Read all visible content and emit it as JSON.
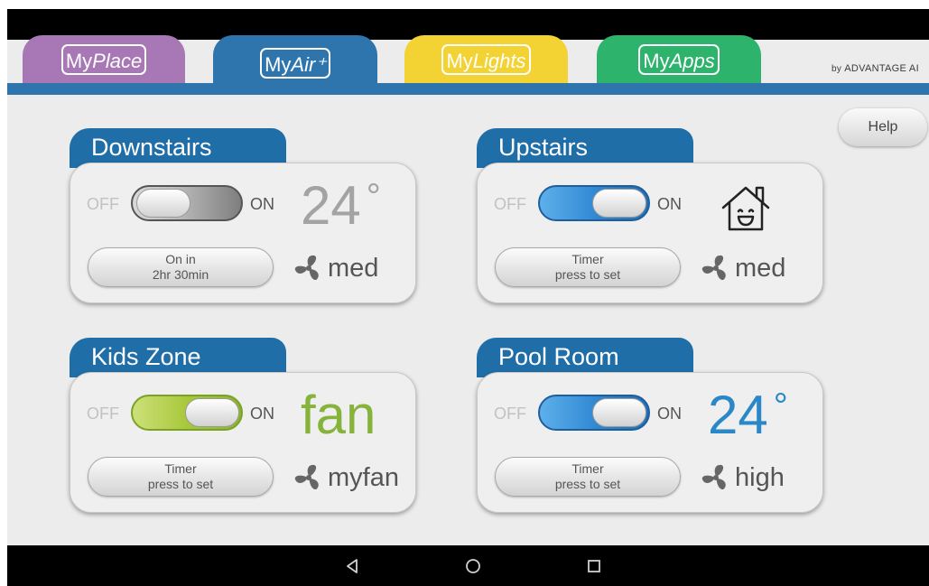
{
  "tabs": [
    {
      "my": "My",
      "rest": "Place",
      "color": "#a877b6"
    },
    {
      "my": "My",
      "rest": "Air⁺",
      "color": "#2e75ad"
    },
    {
      "my": "My",
      "rest": "Lights",
      "color": "#f3d233"
    },
    {
      "my": "My",
      "rest": "Apps",
      "color": "#2db36b"
    }
  ],
  "brand": {
    "by": "by",
    "name": "ADVANTAGE AI"
  },
  "help_label": "Help",
  "zones": [
    {
      "name": "Downstairs",
      "off_label": "OFF",
      "on_label": "ON",
      "state": "off",
      "display": "24",
      "degree": "°",
      "timer_line1": "On in",
      "timer_line2": "2hr 30min",
      "fan_speed": "med"
    },
    {
      "name": "Upstairs",
      "off_label": "OFF",
      "on_label": "ON",
      "state": "on",
      "display_icon": "smiling-house-icon",
      "timer_line1": "Timer",
      "timer_line2": "press to set",
      "fan_speed": "med"
    },
    {
      "name": "Kids Zone",
      "off_label": "OFF",
      "on_label": "ON",
      "state": "on",
      "display": "fan",
      "timer_line1": "Timer",
      "timer_line2": "press to set",
      "fan_speed": "myfan"
    },
    {
      "name": "Pool Room",
      "off_label": "OFF",
      "on_label": "ON",
      "state": "on",
      "display": "24",
      "degree": "°",
      "timer_line1": "Timer",
      "timer_line2": "press to set",
      "fan_speed": "high"
    }
  ],
  "colors": {
    "zone_header": "#1f6ea8",
    "temp_off": "#a3a3a3",
    "temp_on": "#2a88c8",
    "fan_mode": "#86b33b"
  },
  "nav_icons": [
    "back-icon",
    "home-icon",
    "recents-icon"
  ]
}
